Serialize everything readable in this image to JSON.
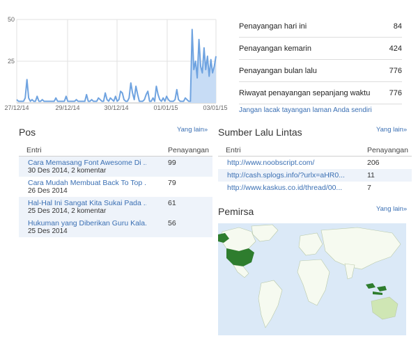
{
  "chart_data": {
    "type": "area",
    "yticks": [
      "50",
      "25"
    ],
    "xticks": [
      "27/12/14",
      "29/12/14",
      "30/12/14",
      "01/01/15",
      "03/01/15"
    ],
    "ylim": [
      0,
      50
    ],
    "values": [
      2,
      1,
      1,
      1,
      1,
      3,
      14,
      3,
      1,
      2,
      1,
      1,
      4,
      1,
      1,
      2,
      1,
      1,
      1,
      1,
      1,
      1,
      1,
      3,
      1,
      1,
      1,
      1,
      1,
      4,
      1,
      1,
      1,
      1,
      1,
      2,
      1,
      1,
      1,
      1,
      1,
      5,
      1,
      1,
      2,
      1,
      1,
      1,
      3,
      2,
      1,
      1,
      6,
      2,
      1,
      3,
      2,
      1,
      4,
      1,
      2,
      7,
      6,
      2,
      1,
      1,
      3,
      12,
      6,
      2,
      10,
      5,
      1,
      1,
      1,
      2,
      5,
      7,
      1,
      1,
      3,
      1,
      10,
      5,
      2,
      1,
      3,
      1,
      4,
      2,
      1,
      1,
      1,
      2,
      8,
      2,
      1,
      1,
      1,
      3,
      2,
      1,
      1,
      44,
      20,
      25,
      15,
      38,
      22,
      18,
      33,
      20,
      28,
      16,
      26,
      18,
      22,
      28
    ],
    "grid": true,
    "colors": {
      "line": "#6fa3e0",
      "fill": "#c7dcf5"
    }
  },
  "stats": {
    "rows": [
      {
        "label": "Penayangan hari ini",
        "value": "84"
      },
      {
        "label": "Penayangan kemarin",
        "value": "424"
      },
      {
        "label": "Penayangan bulan lalu",
        "value": "776"
      },
      {
        "label": "Riwayat penayangan sepanjang waktu",
        "value": "776"
      }
    ],
    "link": "Jangan lacak tayangan laman Anda sendiri"
  },
  "posts": {
    "title": "Pos",
    "more": "Yang lain»",
    "col_entry": "Entri",
    "col_views": "Penayangan",
    "rows": [
      {
        "title": "Cara Memasang Font Awesome Di ...",
        "sub": "30 Des 2014, 2 komentar",
        "views": "99"
      },
      {
        "title": "Cara Mudah Membuat Back To Top ...",
        "sub": "26 Des 2014",
        "views": "79"
      },
      {
        "title": "Hal-Hal Ini Sangat Kita Sukai Pada ...",
        "sub": "25 Des 2014, 2 komentar",
        "views": "61"
      },
      {
        "title": "Hukuman yang Diberikan Guru Kala...",
        "sub": "25 Des 2014",
        "views": "56"
      }
    ]
  },
  "traffic": {
    "title": "Sumber Lalu Lintas",
    "more": "Yang lain»",
    "col_entry": "Entri",
    "col_views": "Penayangan",
    "rows": [
      {
        "url": "http://www.noobscript.com/",
        "views": "206"
      },
      {
        "url": "http://cash.splogs.info/?urlx=aHR0...",
        "views": "11"
      },
      {
        "url": "http://www.kaskus.co.id/thread/00...",
        "views": "7"
      }
    ]
  },
  "audience": {
    "title": "Pemirsa",
    "more": "Yang lain»",
    "colors": {
      "water": "#dbe9f7",
      "land": "#f6faf0",
      "low": "#cfe6b4",
      "mid": "#8bc17a",
      "high": "#2e7d2e"
    }
  }
}
